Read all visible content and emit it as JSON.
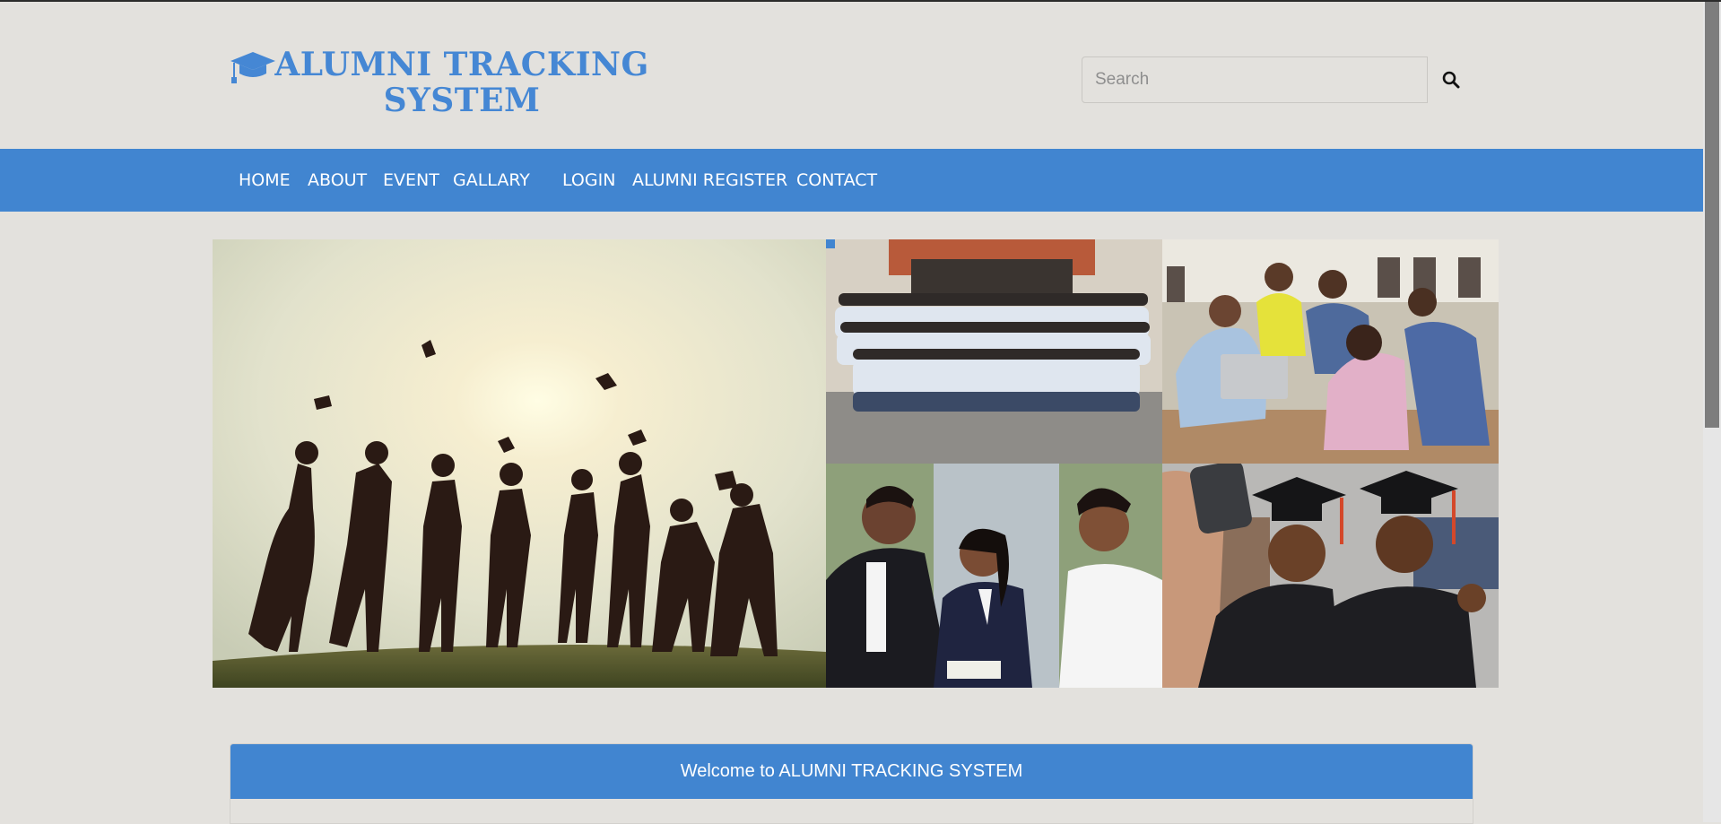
{
  "header": {
    "logo_line1": "ALUMNI TRACKING",
    "logo_line2": "SYSTEM",
    "logo_icon": "graduation-cap-icon",
    "search_placeholder": "Search",
    "search_icon": "search-icon"
  },
  "nav": {
    "items": [
      {
        "label": "HOME"
      },
      {
        "label": "ABOUT"
      },
      {
        "label": "EVENT"
      },
      {
        "label": "GALLARY"
      },
      {
        "label": "LOGIN"
      },
      {
        "label": "ALUMNI REGISTER"
      },
      {
        "label": "CONTACT"
      }
    ]
  },
  "gallery": {
    "images": [
      {
        "subject": "graduates silhouettes throwing caps at sunset"
      },
      {
        "subject": "class group photo"
      },
      {
        "subject": "students with laptop on steps"
      },
      {
        "subject": "professionals discussing"
      },
      {
        "subject": "graduates taking selfie"
      }
    ]
  },
  "welcome": {
    "title": "Welcome to ALUMNI TRACKING SYSTEM"
  },
  "colors": {
    "brand_blue": "#4185d0",
    "logo_blue": "#4587d4",
    "background": "#e3e1dd"
  }
}
